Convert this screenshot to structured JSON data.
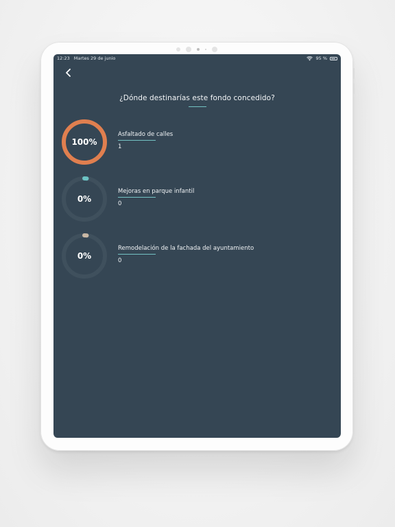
{
  "status_bar": {
    "time": "12:23",
    "date": "Martes 29 de junio",
    "battery": "95 %"
  },
  "icons": {
    "back": "chevron-left-icon",
    "wifi": "wifi-icon",
    "battery": "battery-icon"
  },
  "survey": {
    "question": "¿Dónde destinarías este fondo concedido?",
    "options": [
      {
        "label": "Asfaltado de calles",
        "percent_label": "100%",
        "percent": 100,
        "count": "1",
        "color": "#e07f4f"
      },
      {
        "label": "Mejoras en parque infantil",
        "percent_label": "0%",
        "percent": 0,
        "count": "0",
        "color": "#6cc3c4"
      },
      {
        "label": "Remodelación de la fachada del ayuntamiento",
        "percent_label": "0%",
        "percent": 0,
        "count": "0",
        "color": "#c9b8a5"
      }
    ]
  },
  "colors": {
    "background": "#354654",
    "ring_track": "#3f505d",
    "accent_underline": "#74c3c4"
  }
}
